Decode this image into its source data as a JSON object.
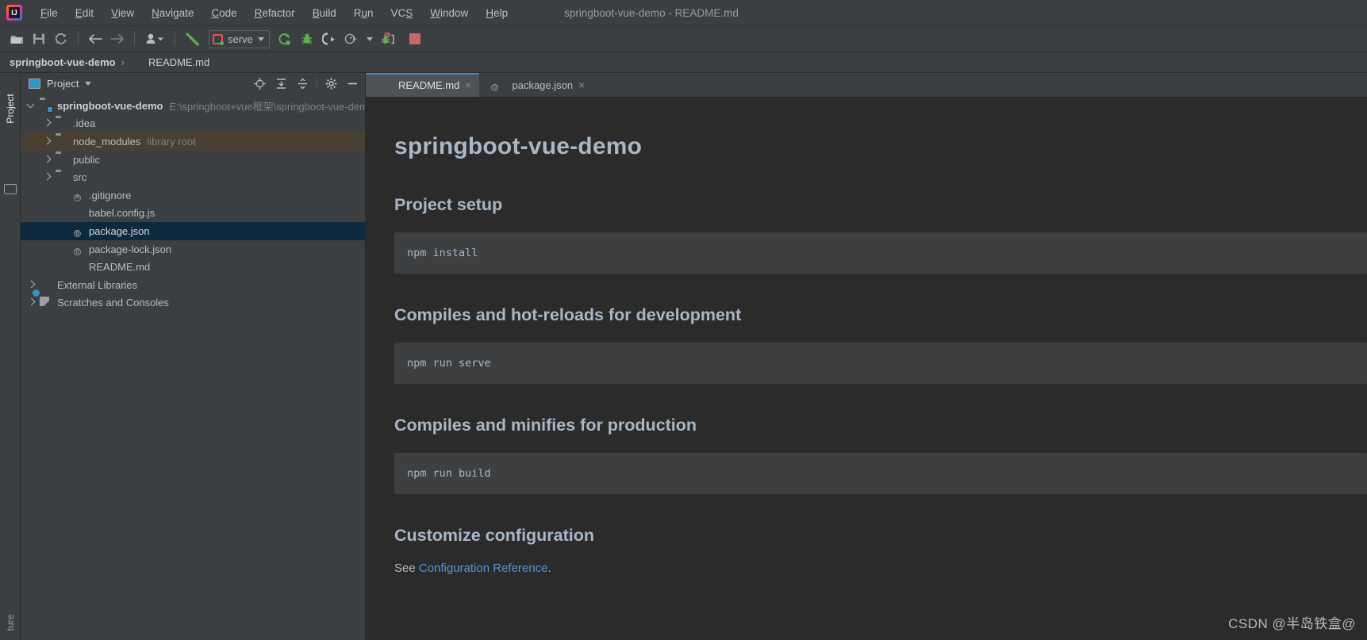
{
  "window": {
    "title": "springboot-vue-demo - README.md",
    "logo_icon": "intellij-idea-logo"
  },
  "menubar": {
    "items": [
      {
        "label": "File",
        "mnemonic": "F"
      },
      {
        "label": "Edit",
        "mnemonic": "E"
      },
      {
        "label": "View",
        "mnemonic": "V"
      },
      {
        "label": "Navigate",
        "mnemonic": "N"
      },
      {
        "label": "Code",
        "mnemonic": "C"
      },
      {
        "label": "Refactor",
        "mnemonic": "R"
      },
      {
        "label": "Build",
        "mnemonic": "B"
      },
      {
        "label": "Run",
        "mnemonic": "u"
      },
      {
        "label": "VCS",
        "mnemonic": "S"
      },
      {
        "label": "Window",
        "mnemonic": "W"
      },
      {
        "label": "Help",
        "mnemonic": "H"
      }
    ]
  },
  "toolbar": {
    "open_icon": "open-folder-icon",
    "save_icon": "save-icon",
    "sync_icon": "sync-refresh-icon",
    "back_icon": "arrow-left-icon",
    "forward_icon": "arrow-right-icon",
    "profile_icon": "user-profile-icon",
    "build_icon": "build-hammer-icon",
    "run_config_label": "serve",
    "run_config_icon": "run-config-vue-icon",
    "run_icon": "run-icon",
    "debug_icon": "debug-bug-icon",
    "run_coverage_icon": "run-with-coverage-icon",
    "profiler_icon": "profiler-icon",
    "attach_debug_icon": "attach-debugger-icon",
    "stop_icon": "stop-icon"
  },
  "breadcrumb": {
    "project": "springboot-vue-demo",
    "separator": "›",
    "file": "README.md",
    "file_icon": "markdown-file-icon"
  },
  "left_strip": {
    "project_tab": "Project",
    "structure_tab": "ture",
    "favorites_icon": "favorites-icon"
  },
  "project_panel": {
    "title": "Project",
    "title_icon": "project-view-icon",
    "dropdown_icon": "chevron-down-icon",
    "actions": [
      {
        "name": "locate-file-icon"
      },
      {
        "name": "expand-all-icon"
      },
      {
        "name": "collapse-all-icon"
      },
      {
        "name": "settings-gear-icon"
      },
      {
        "name": "hide-panel-icon"
      }
    ],
    "tree": [
      {
        "label": "springboot-vue-demo",
        "hint": "E:\\springboot+vue框架\\springboot-vue-dem",
        "icon": "project-module-folder-icon",
        "depth": 0,
        "twisty": "open",
        "bold": true,
        "state": "normal"
      },
      {
        "label": ".idea",
        "hint": "",
        "icon": "folder-icon",
        "depth": 1,
        "twisty": "closed",
        "bold": false,
        "state": "normal"
      },
      {
        "label": "node_modules",
        "hint": "library root",
        "icon": "folder-icon",
        "depth": 1,
        "twisty": "closed",
        "bold": false,
        "state": "hover"
      },
      {
        "label": "public",
        "hint": "",
        "icon": "folder-icon",
        "depth": 1,
        "twisty": "closed",
        "bold": false,
        "state": "normal"
      },
      {
        "label": "src",
        "hint": "",
        "icon": "folder-icon",
        "depth": 1,
        "twisty": "closed",
        "bold": false,
        "state": "normal"
      },
      {
        "label": ".gitignore",
        "hint": "",
        "icon": "gitignore-file-icon",
        "depth": 2,
        "twisty": "none",
        "bold": false,
        "state": "normal"
      },
      {
        "label": "babel.config.js",
        "hint": "",
        "icon": "javascript-file-icon",
        "depth": 2,
        "twisty": "none",
        "bold": false,
        "state": "normal"
      },
      {
        "label": "package.json",
        "hint": "",
        "icon": "json-file-icon",
        "depth": 2,
        "twisty": "none",
        "bold": false,
        "state": "selected"
      },
      {
        "label": "package-lock.json",
        "hint": "",
        "icon": "json-file-icon",
        "depth": 2,
        "twisty": "none",
        "bold": false,
        "state": "normal"
      },
      {
        "label": "README.md",
        "hint": "",
        "icon": "markdown-file-icon",
        "depth": 2,
        "twisty": "none",
        "bold": false,
        "state": "normal"
      },
      {
        "label": "External Libraries",
        "hint": "",
        "icon": "external-libraries-icon",
        "depth": 0,
        "twisty": "closed",
        "bold": false,
        "state": "normal"
      },
      {
        "label": "Scratches and Consoles",
        "hint": "",
        "icon": "scratches-icon",
        "depth": 0,
        "twisty": "closed",
        "bold": false,
        "state": "normal"
      }
    ]
  },
  "editor": {
    "tabs": [
      {
        "label": "README.md",
        "icon": "markdown-file-icon",
        "active": true,
        "close": "×"
      },
      {
        "label": "package.json",
        "icon": "json-file-icon",
        "active": false,
        "close": "×"
      }
    ]
  },
  "preview": {
    "h1": "springboot-vue-demo",
    "sections": [
      {
        "heading": "Project setup",
        "code": "npm install"
      },
      {
        "heading": "Compiles and hot-reloads for development",
        "code": "npm run serve"
      },
      {
        "heading": "Compiles and minifies for production",
        "code": "npm run build"
      }
    ],
    "last_heading": "Customize configuration",
    "last_paragraph_prefix": "See ",
    "last_paragraph_link": "Configuration Reference",
    "last_paragraph_suffix": "."
  },
  "watermark": {
    "text": "CSDN @半岛铁盒@"
  }
}
